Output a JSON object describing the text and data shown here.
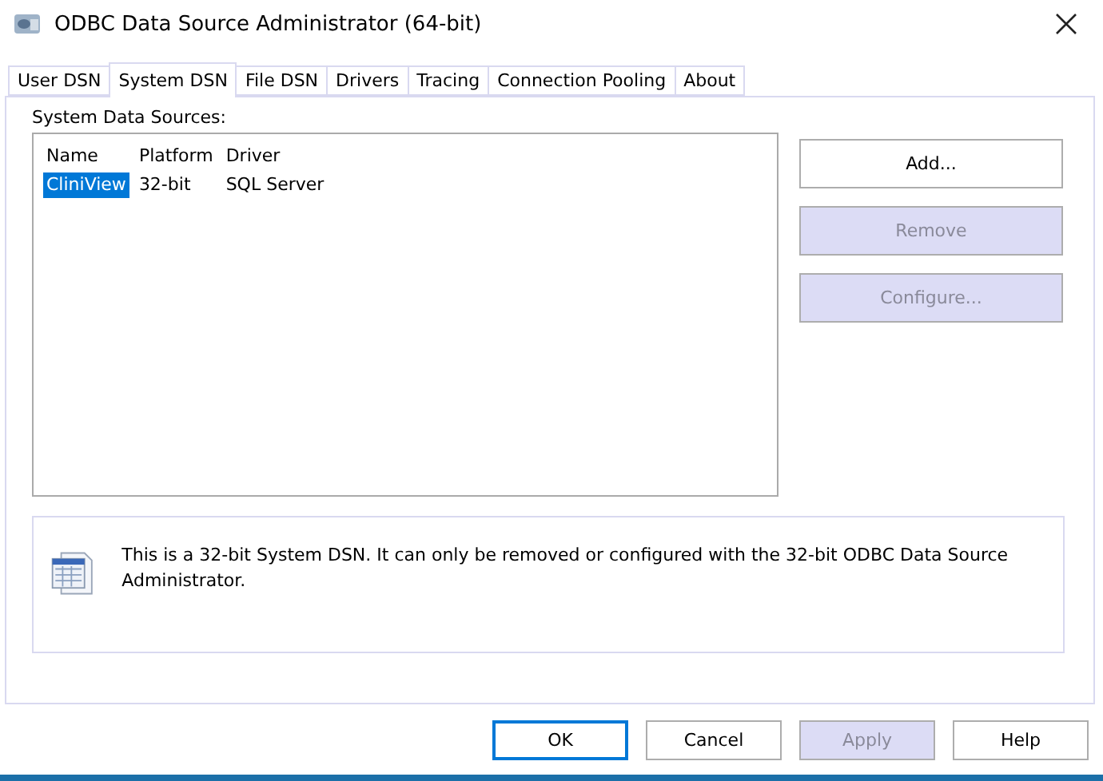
{
  "window": {
    "title": "ODBC Data Source Administrator (64-bit)"
  },
  "tabs": [
    {
      "label": "User DSN",
      "selected": false
    },
    {
      "label": "System DSN",
      "selected": true
    },
    {
      "label": "File DSN",
      "selected": false
    },
    {
      "label": "Drivers",
      "selected": false
    },
    {
      "label": "Tracing",
      "selected": false
    },
    {
      "label": "Connection Pooling",
      "selected": false
    },
    {
      "label": "About",
      "selected": false
    }
  ],
  "group_label": "System Data Sources:",
  "table": {
    "columns": [
      "Name",
      "Platform",
      "Driver"
    ],
    "rows": [
      {
        "cells": [
          "CliniView",
          "32-bit",
          "SQL Server"
        ],
        "selected": true
      }
    ]
  },
  "side_buttons": [
    {
      "label": "Add...",
      "disabled": false
    },
    {
      "label": "Remove",
      "disabled": true
    },
    {
      "label": "Configure...",
      "disabled": true
    }
  ],
  "info_text": "This is a 32-bit System DSN. It can only be removed or configured with the 32-bit ODBC Data Source Administrator.",
  "footer_buttons": [
    {
      "label": "OK",
      "disabled": false,
      "default": true
    },
    {
      "label": "Cancel",
      "disabled": false,
      "default": false
    },
    {
      "label": "Apply",
      "disabled": true,
      "default": false
    },
    {
      "label": "Help",
      "disabled": false,
      "default": false
    }
  ]
}
